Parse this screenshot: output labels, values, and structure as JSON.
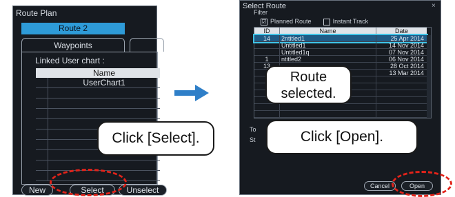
{
  "route_plan": {
    "title": "Route Plan",
    "route_tab": "Route 2",
    "tabs": [
      "Waypoints"
    ],
    "linked_label": "Linked User chart :",
    "table": {
      "column_name": "Name",
      "rows": [
        "UserChart1",
        "",
        "",
        "",
        "",
        "",
        "",
        "",
        "",
        ""
      ]
    },
    "buttons": {
      "new": "New",
      "select": "Select",
      "unselect": "Unselect"
    }
  },
  "callouts": {
    "click_select": "Click [Select].",
    "route_selected_line1": "Route",
    "route_selected_line2": "selected.",
    "click_open": "Click [Open]."
  },
  "select_route": {
    "title": "Select Route",
    "close_glyph": "×",
    "filter_label": "Filter",
    "filters": {
      "planned_route": "Planned Route",
      "instant_track": "Instant Track",
      "planned_checked": "☑",
      "instant_checked": "☐"
    },
    "columns": {
      "id": "ID",
      "name": "Name",
      "date": "Date"
    },
    "rows": [
      {
        "id": "14",
        "name": "2ntitled1",
        "date": "25 Apr 2014",
        "selected": true
      },
      {
        "id": "",
        "name": "Untitled1",
        "date": "14 Nov 2014"
      },
      {
        "id": "",
        "name": "Untitled1q",
        "date": "07 Nov 2014"
      },
      {
        "id": "1",
        "name": "ntitled2",
        "date": "06 Nov 2014"
      },
      {
        "id": "13",
        "name": "",
        "date": "28 Oct 2014"
      },
      {
        "id": "",
        "name": "",
        "date": "13 Mar 2014"
      },
      {
        "id": "",
        "name": "",
        "date": ""
      },
      {
        "id": "",
        "name": "",
        "date": ""
      },
      {
        "id": "",
        "name": "",
        "date": ""
      },
      {
        "id": "",
        "name": "",
        "date": ""
      },
      {
        "id": "",
        "name": "",
        "date": ""
      },
      {
        "id": "",
        "name": "",
        "date": ""
      }
    ],
    "left_cut_1": "To",
    "left_cut_2": "St",
    "buttons": {
      "cancel": "Cancel",
      "open": "Open"
    }
  },
  "colors": {
    "accent": "#2e9bd8",
    "selection_outline": "#3fc3e6",
    "highlight_dash": "#e2231a",
    "arrow": "#2f7fc8"
  }
}
